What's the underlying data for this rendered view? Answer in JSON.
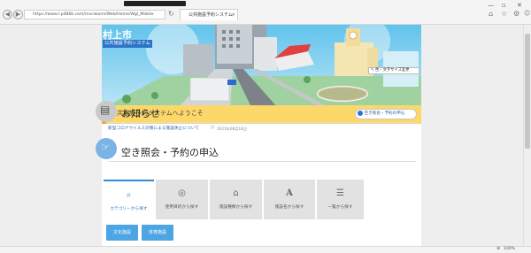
{
  "browser": {
    "address": "https://www.l-p486k.com/murakami/Web/Home/Wgl_Mobile",
    "tab_title": "公共施設予約システム"
  },
  "site": {
    "city": "村上市",
    "system_name": "公共施設予約システム",
    "font_size_button": "色・文字サイズ変更",
    "welcome": "公共施設予約システムへようこそ",
    "reserve_button": "空き照会・予約の申込"
  },
  "news": {
    "heading": "お知らせ",
    "item_title": "新型コロナウイルス対策による施設休止について",
    "item_date": "2021年08月18日"
  },
  "reserve": {
    "heading": "空き照会・予約の申込",
    "tabs": [
      {
        "label": "カテゴリーから探す",
        "icon": "search-icon"
      },
      {
        "label": "使用目的から探す",
        "icon": "compass-icon"
      },
      {
        "label": "施設種類から探す",
        "icon": "building-icon"
      },
      {
        "label": "施設名から探す",
        "icon": "font-icon"
      },
      {
        "label": "一覧から探す",
        "icon": "list-icon"
      }
    ],
    "categories": [
      "文化施設",
      "体育施設"
    ]
  },
  "status": {
    "zoom": "100%"
  }
}
